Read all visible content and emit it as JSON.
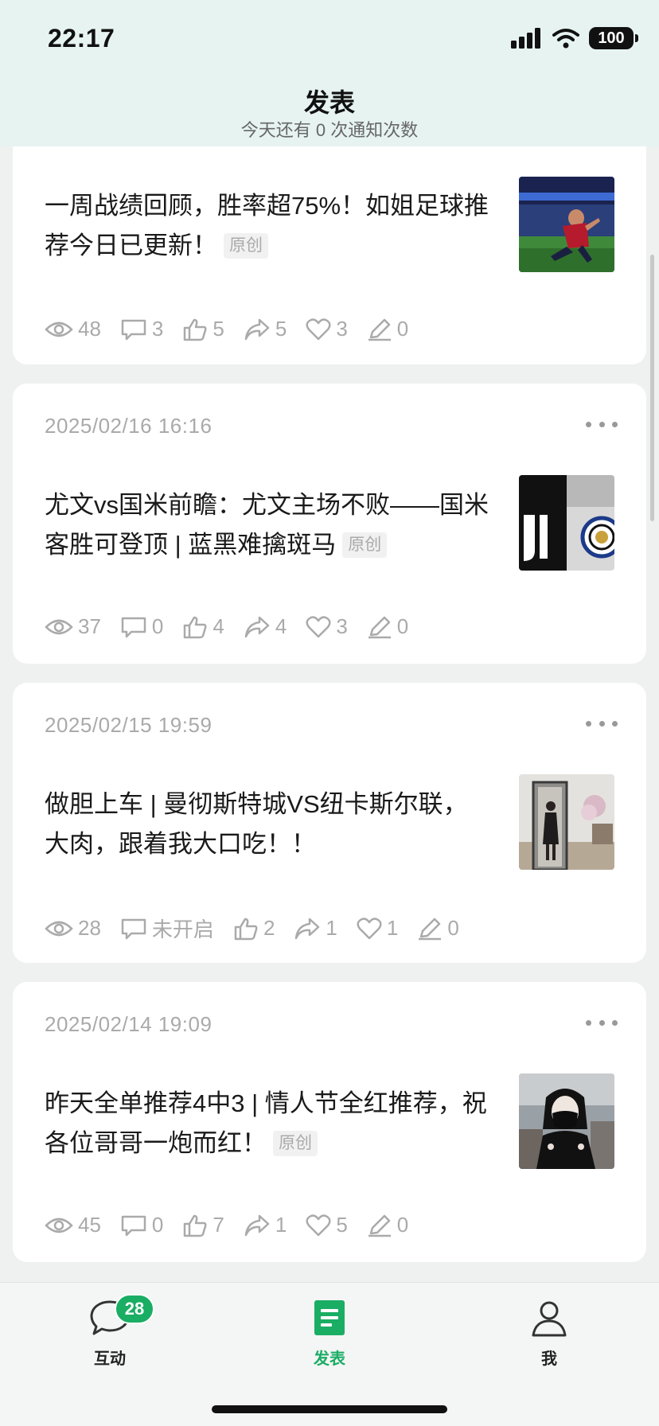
{
  "status": {
    "time": "22:17",
    "battery": "100"
  },
  "header": {
    "title": "发表",
    "subtitle": "今天还有 0 次通知次数"
  },
  "posts": [
    {
      "date": "",
      "title": "一周战绩回顾，胜率超75%！如姐足球推荐今日已更新！",
      "badge": "原创",
      "image": "soccer-player-photo",
      "stats": {
        "views": "48",
        "comments": "3",
        "likes": "5",
        "shares": "5",
        "favorites": "3",
        "edits": "0"
      }
    },
    {
      "date": "2025/02/16 16:16",
      "title": "尤文vs国米前瞻：尤文主场不败——国米客胜可登顶 | 蓝黑难擒斑马",
      "badge": "原创",
      "image": "juventus-inter-logos",
      "stats": {
        "views": "37",
        "comments": "0",
        "likes": "4",
        "shares": "4",
        "favorites": "3",
        "edits": "0"
      }
    },
    {
      "date": "2025/02/15 19:59",
      "title": "做胆上车 | 曼彻斯特城VS纽卡斯尔联，大肉，跟着我大口吃！！",
      "badge": "",
      "image": "mirror-selfie-photo",
      "stats": {
        "views": "28",
        "comments": "未开启",
        "likes": "2",
        "shares": "1",
        "favorites": "1",
        "edits": "0"
      }
    },
    {
      "date": "2025/02/14 19:09",
      "title": "昨天全单推荐4中3 | 情人节全红推荐，祝各位哥哥一炮而红！",
      "badge": "原创",
      "image": "masked-woman-photo",
      "stats": {
        "views": "45",
        "comments": "0",
        "likes": "7",
        "shares": "1",
        "favorites": "5",
        "edits": "0"
      }
    }
  ],
  "tabbar": {
    "tabs": [
      {
        "label": "互动",
        "icon": "chat-bubble-icon",
        "badge": "28"
      },
      {
        "label": "发表",
        "icon": "document-icon",
        "active": true
      },
      {
        "label": "我",
        "icon": "person-icon"
      }
    ]
  },
  "colors": {
    "accent": "#1aad64",
    "header_bg": "#e6f3f1",
    "page_bg": "#eef1f0",
    "muted": "#aaaaaa"
  }
}
